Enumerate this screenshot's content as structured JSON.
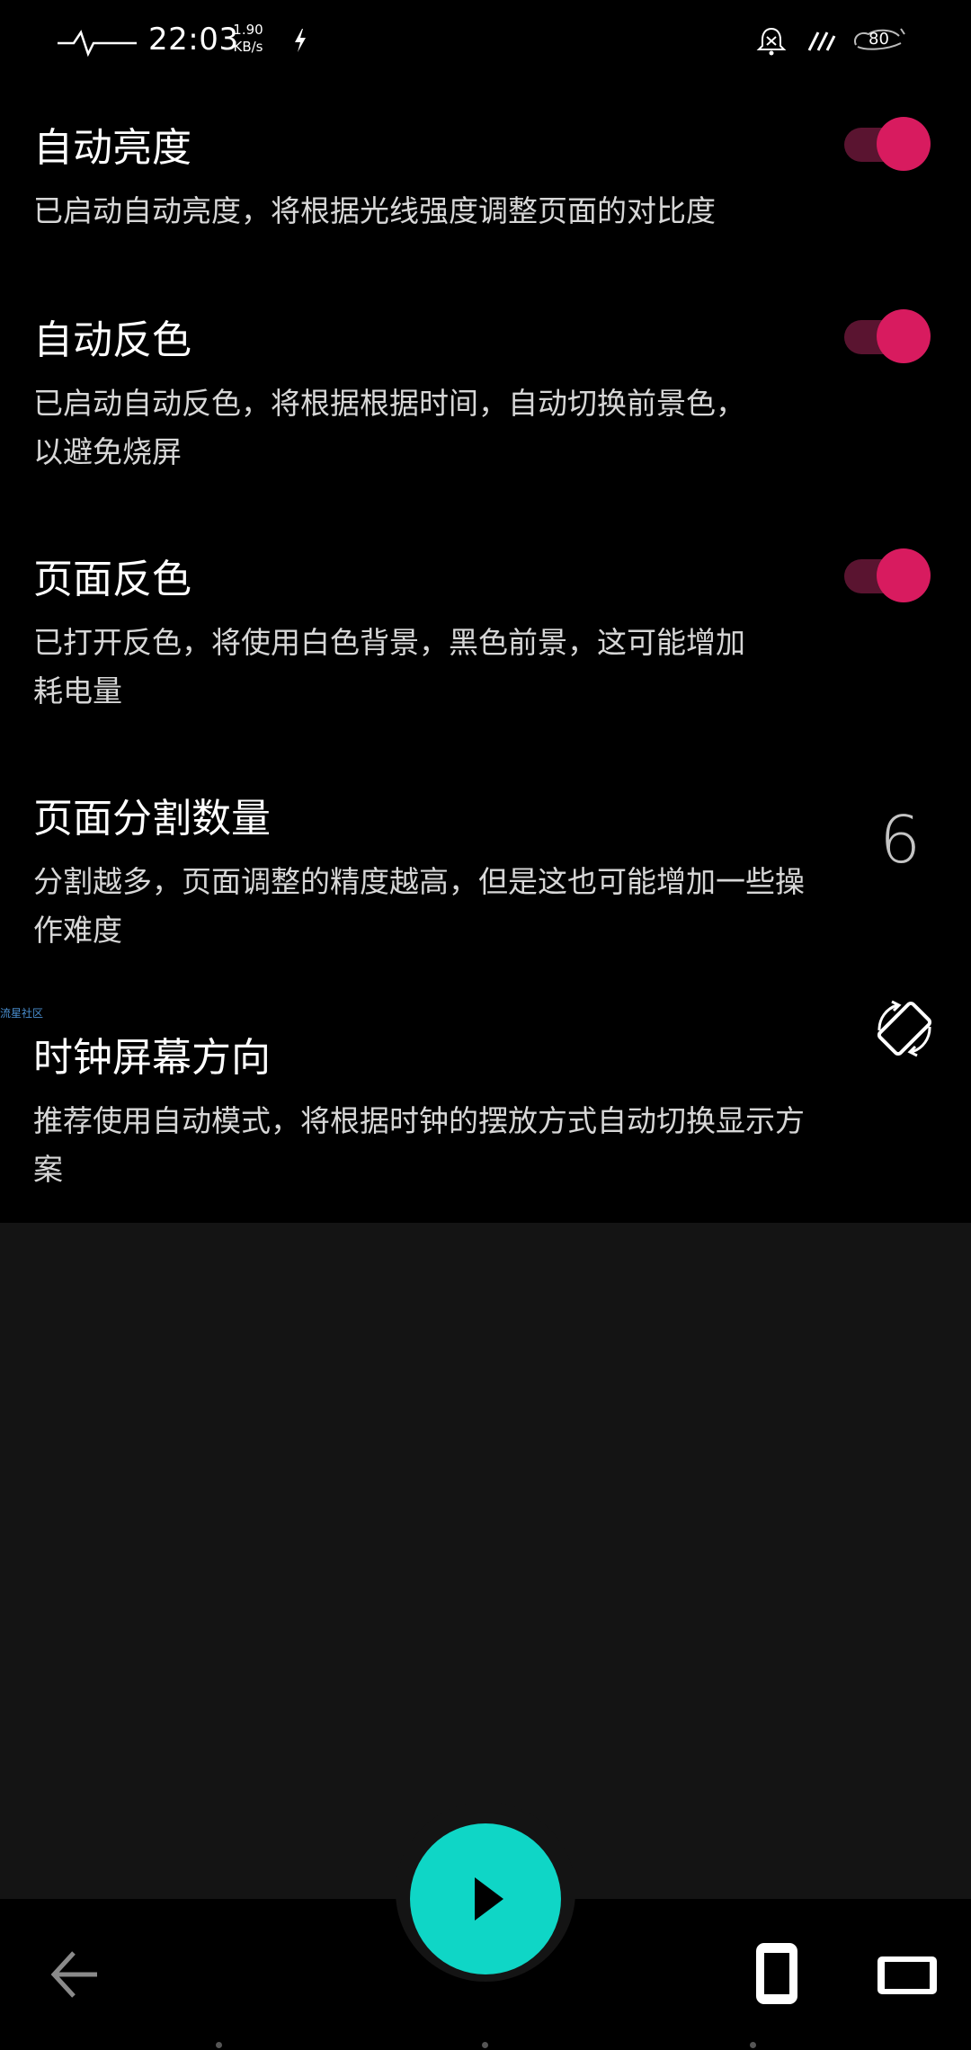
{
  "status_bar": {
    "time": "22:03",
    "net_speed_value": "1.90",
    "net_speed_unit": "KB/s",
    "battery_level": "80"
  },
  "settings": {
    "auto_brightness": {
      "title": "自动亮度",
      "description": "已启动自动亮度，将根据光线强度调整页面的对比度",
      "enabled": true
    },
    "auto_invert": {
      "title": "自动反色",
      "description_lines": [
        "已启动自动反色，将根据根据时间，自动切换前景色，",
        "以避免烧屏"
      ],
      "enabled": true
    },
    "page_invert": {
      "title": "页面反色",
      "description_lines": [
        "已打开反色，将使用白色背景，黑色前景，这可能增加",
        "耗电量"
      ],
      "enabled": true
    },
    "page_split_count": {
      "title": "页面分割数量",
      "description_lines": [
        "分割越多，页面调整的精度越高，但是这也可能增加一些操",
        "作难度"
      ],
      "value": "6"
    },
    "clock_orientation": {
      "title": "时钟屏幕方向",
      "description_lines": [
        "推荐使用自动模式，将根据时钟的摆放方式自动切换显示方",
        "案"
      ],
      "icon": "screen-rotation-icon",
      "watermark": "流星社区"
    }
  },
  "bottom_bar": {
    "icons": [
      "back-arrow-icon",
      "play-icon",
      "phone-portrait-icon",
      "phone-landscape-icon"
    ]
  },
  "colors": {
    "accent_pink": "#d81b5f",
    "fab_teal": "#0fd6c6",
    "panel_bg": "#000000",
    "page_bg": "#141414"
  }
}
